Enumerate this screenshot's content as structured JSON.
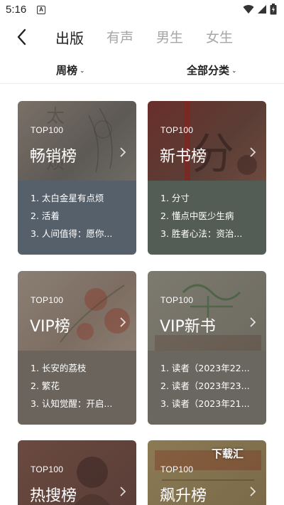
{
  "status": {
    "time": "5:16",
    "notification_glyph": "A"
  },
  "nav": {
    "tabs": [
      {
        "label": "出版",
        "active": true
      },
      {
        "label": "有声",
        "active": false
      },
      {
        "label": "男生",
        "active": false
      },
      {
        "label": "女生",
        "active": false
      }
    ]
  },
  "filters": {
    "period": "周榜",
    "category": "全部分类"
  },
  "cards": [
    {
      "tag": "TOP100",
      "title": "畅销榜",
      "items": [
        "1. 太白金星有点烦",
        "2. 活着",
        "3. 人间值得：愿你..."
      ]
    },
    {
      "tag": "TOP100",
      "title": "新书榜",
      "items": [
        "1. 分寸",
        "2. 懂点中医少生病",
        "3. 胜者心法：资治..."
      ]
    },
    {
      "tag": "TOP100",
      "title": "VIP榜",
      "items": [
        "1. 长安的荔枝",
        "2. 繁花",
        "3. 认知觉醒：开启..."
      ]
    },
    {
      "tag": "TOP100",
      "title": "VIP新书",
      "items": [
        "1. 读者（2023年22...",
        "2. 读者（2023年23...",
        "3. 读者（2023年21..."
      ]
    },
    {
      "tag": "TOP100",
      "title": "热搜榜",
      "items": []
    },
    {
      "tag": "TOP100",
      "title": "飙升榜",
      "items": []
    }
  ],
  "watermark": "下载汇",
  "colors": {
    "active_tab": "#222222",
    "inactive_tab": "#a6a6a6",
    "background": "#ffffff"
  }
}
